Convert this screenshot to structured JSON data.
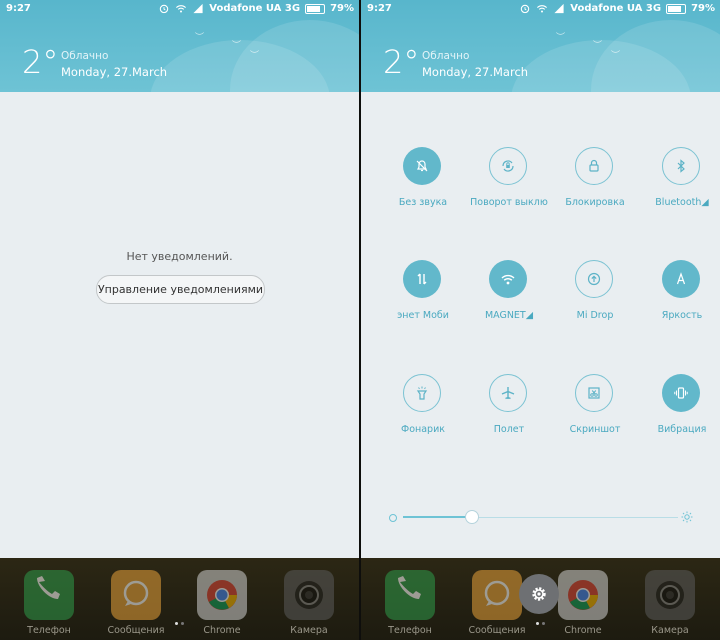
{
  "status_bar": {
    "time": "9:27",
    "carrier": "Vodafone UA 3G",
    "battery": "79%",
    "battery_level": 0.79
  },
  "weather": {
    "temperature": "2°",
    "condition": "Облачно",
    "date": "Monday, 27.March"
  },
  "notifications": {
    "empty_text": "Нет уведомлений.",
    "manage_label": "Управление уведомлениями"
  },
  "quick_settings": {
    "tiles": [
      {
        "label": "Без звука",
        "icon": "bell-off-icon",
        "active": true
      },
      {
        "label": "Поворот выклю",
        "icon": "rotation-lock-icon",
        "active": false
      },
      {
        "label": "Блокировка",
        "icon": "lock-icon",
        "active": false
      },
      {
        "label": "Bluetooth◢",
        "icon": "bluetooth-icon",
        "active": false
      },
      {
        "label": "энет      Моби",
        "icon": "mobile-data-icon",
        "active": true
      },
      {
        "label": "MAGNET◢",
        "icon": "wifi-icon",
        "active": true
      },
      {
        "label": "Mi Drop",
        "icon": "mi-drop-icon",
        "active": false
      },
      {
        "label": "Яркость",
        "icon": "auto-brightness-icon",
        "active": true
      },
      {
        "label": "Фонарик",
        "icon": "flashlight-icon",
        "active": false
      },
      {
        "label": "Полет",
        "icon": "airplane-icon",
        "active": false
      },
      {
        "label": "Скриншот",
        "icon": "screenshot-icon",
        "active": false
      },
      {
        "label": "Вибрация",
        "icon": "vibrate-icon",
        "active": true
      }
    ],
    "brightness_level": 0.25
  },
  "dock": {
    "apps": [
      {
        "label": "Телефон",
        "icon": "phone-icon",
        "color": "#2e9b4a"
      },
      {
        "label": "Сообщения",
        "icon": "messages-icon",
        "color": "#e8a23a"
      },
      {
        "label": "Chrome",
        "icon": "chrome-icon",
        "color": "#cfcfcf"
      },
      {
        "label": "Камера",
        "icon": "camera-icon",
        "color": "#5a5a5a"
      }
    ]
  },
  "colors": {
    "accent": "#62b8cb",
    "header": "#5fb9cf",
    "background": "#e9eef1"
  }
}
